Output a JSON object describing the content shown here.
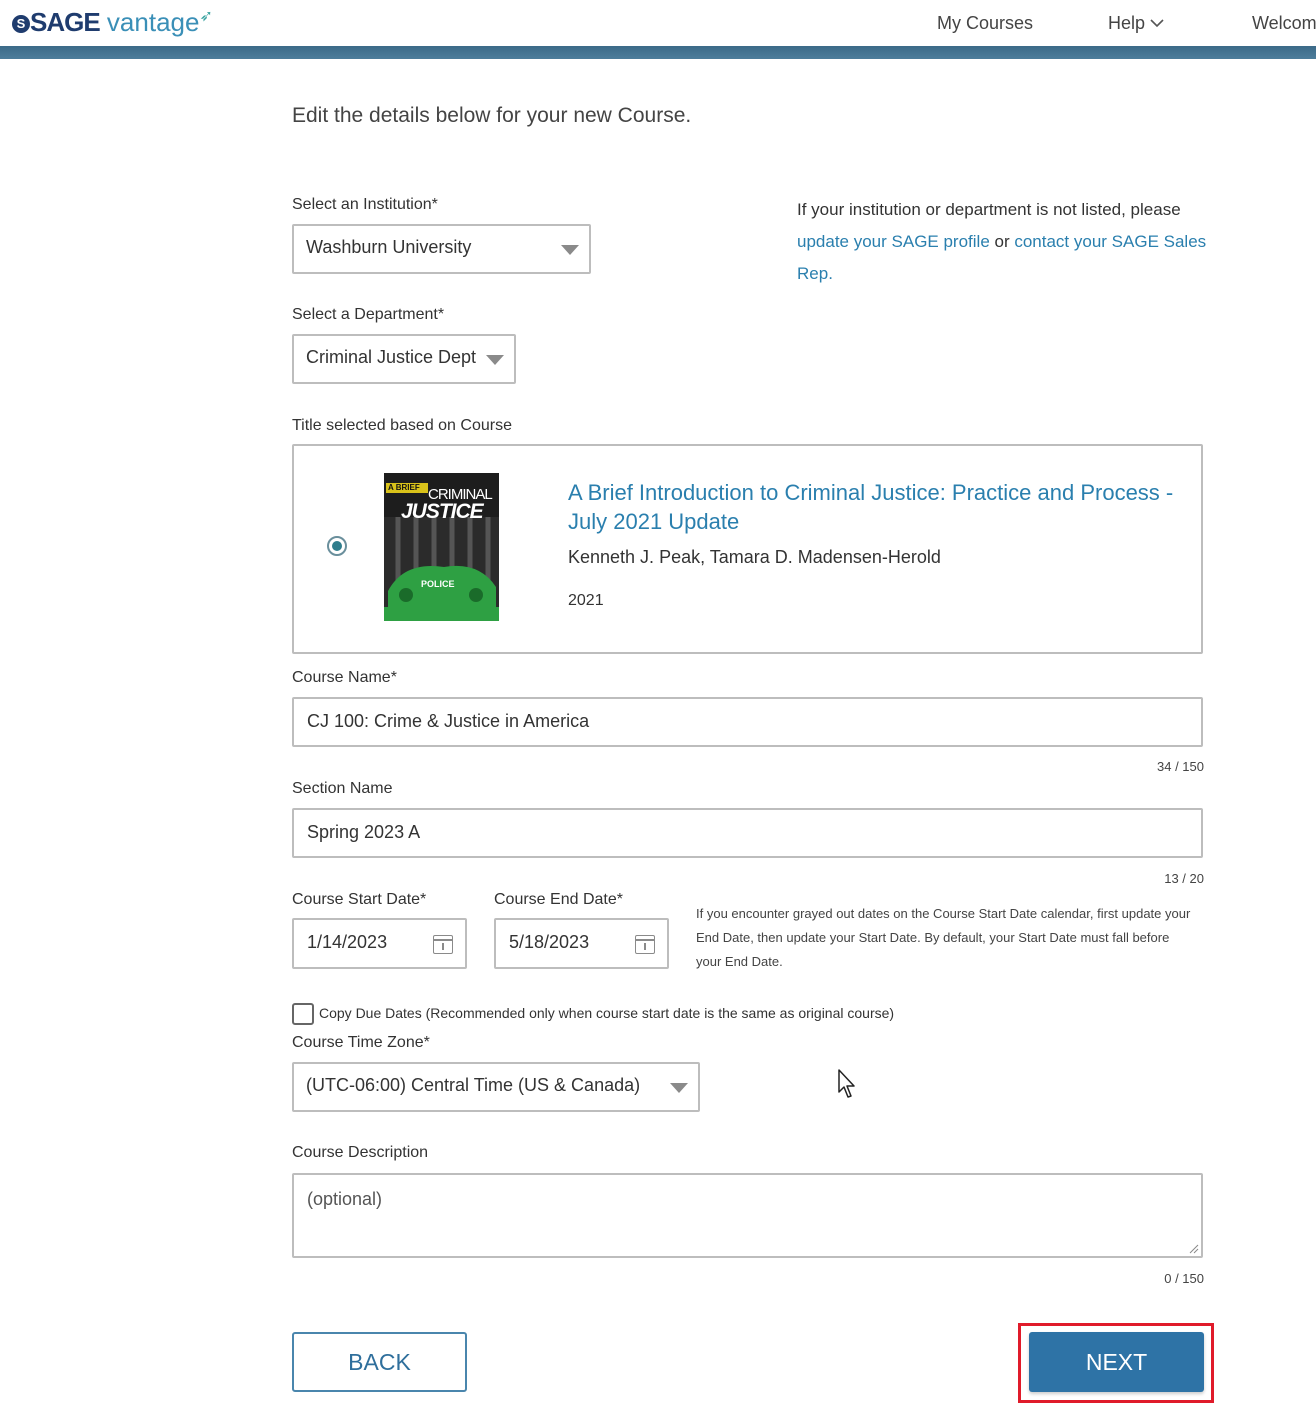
{
  "header": {
    "logo_sage": "SAGE",
    "logo_vantage": "vantage",
    "nav_my_courses": "My Courses",
    "nav_help": "Help",
    "nav_welcome": "Welcom"
  },
  "intro": "Edit the details below for your new Course.",
  "institution": {
    "label": "Select an Institution*",
    "value": "Washburn University"
  },
  "info": {
    "text1": "If your institution or department is not listed, please ",
    "link1": "update your SAGE profile",
    "text2": " or ",
    "link2": "contact your SAGE Sales Rep",
    "text3": "."
  },
  "department": {
    "label": "Select a Department*",
    "value": "Criminal Justice Dept"
  },
  "title_section": {
    "label": "Title selected based on Course",
    "book_title": "A Brief Introduction to Criminal Justice: Practice and Process - July 2021 Update",
    "authors": "Kenneth J. Peak, Tamara D. Madensen-Herold",
    "year": "2021",
    "cover_text_1": "A BRIEF",
    "cover_text_2": "CRIMINAL",
    "cover_text_3": "JUSTICE",
    "cover_text_4": "POLICE"
  },
  "course_name": {
    "label": "Course Name*",
    "value": "CJ 100: Crime & Justice in America",
    "counter": "34 / 150"
  },
  "section_name": {
    "label": "Section Name",
    "value": "Spring 2023 A",
    "counter": "13 / 20"
  },
  "dates": {
    "start_label": "Course Start Date*",
    "start_value": "1/14/2023",
    "end_label": "Course End Date*",
    "end_value": "5/18/2023",
    "note": "If you encounter grayed out dates on the Course Start Date calendar, first update your End Date, then update your Start Date. By default, your Start Date must fall before your End Date."
  },
  "copy_due_dates": {
    "label": "Copy Due Dates (Recommended only when course start date is the same as original course)",
    "checked": false
  },
  "time_zone": {
    "label": "Course Time Zone*",
    "value": "(UTC-06:00) Central Time (US & Canada)"
  },
  "description": {
    "label": "Course Description",
    "placeholder": "(optional)",
    "counter": "0 / 150"
  },
  "buttons": {
    "back": "BACK",
    "next": "NEXT"
  },
  "colors": {
    "accent": "#2a7fae",
    "primary_button": "#2e73a6",
    "highlight": "#e01b2a",
    "header_bar": "#3b6a88"
  }
}
